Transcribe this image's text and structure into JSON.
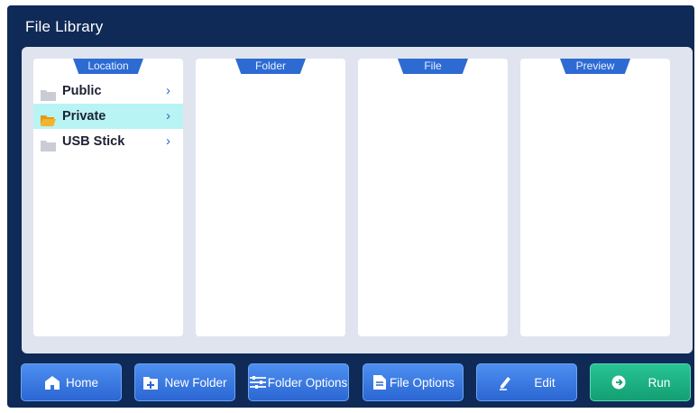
{
  "window": {
    "title": "File Library"
  },
  "columns": {
    "location": "Location",
    "folder": "Folder",
    "file": "File",
    "preview": "Preview"
  },
  "locations": [
    {
      "label": "Public",
      "icon": "folder-gray-icon",
      "selected": false
    },
    {
      "label": "Private",
      "icon": "folder-open-orange-icon",
      "selected": true
    },
    {
      "label": "USB Stick",
      "icon": "folder-gray-icon",
      "selected": false
    }
  ],
  "toolbar": {
    "home": "Home",
    "new_folder": "New Folder",
    "folder_options": "Folder Options",
    "file_options": "File Options",
    "edit": "Edit",
    "run": "Run"
  },
  "colors": {
    "background": "#0f2a57",
    "panel": "#dfe4ef",
    "accent": "#2d6bd3",
    "selected_row": "#b8f4f4",
    "run_button": "#19b082"
  }
}
